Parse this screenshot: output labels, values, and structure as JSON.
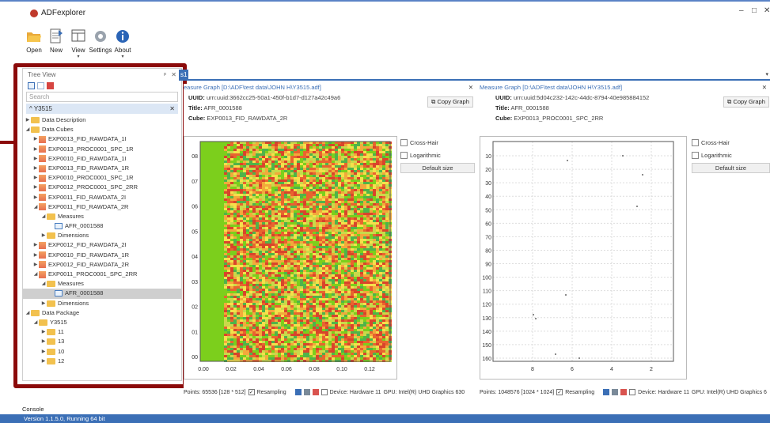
{
  "app": {
    "name": "ADFexplorer",
    "minimize": "–",
    "maximize": "□",
    "close": "✕"
  },
  "ribbon": [
    {
      "label": "Open",
      "icon": "folder-open-icon"
    },
    {
      "label": "New",
      "icon": "new-document-icon"
    },
    {
      "label": "View",
      "icon": "view-icon"
    },
    {
      "label": "Settings",
      "icon": "gear-icon"
    },
    {
      "label": "About",
      "icon": "info-icon"
    }
  ],
  "tree_view": {
    "title": "Tree View",
    "pin": "ᵖ",
    "close": "✕",
    "search_placeholder": "Search",
    "filter": "Y3515",
    "items": [
      {
        "t": "Data Description",
        "lvl": 0,
        "k": "folder",
        "exp": "▶"
      },
      {
        "t": "Data Cubes",
        "lvl": 0,
        "k": "folder",
        "exp": "◢"
      },
      {
        "t": "EXP0013_FID_RAWDATA_1I",
        "lvl": 1,
        "k": "cube",
        "exp": "▶"
      },
      {
        "t": "EXP0013_PROC0001_SPC_1R",
        "lvl": 1,
        "k": "cube",
        "exp": "▶"
      },
      {
        "t": "EXP0010_FID_RAWDATA_1I",
        "lvl": 1,
        "k": "cube",
        "exp": "▶"
      },
      {
        "t": "EXP0013_FID_RAWDATA_1R",
        "lvl": 1,
        "k": "cube",
        "exp": "▶"
      },
      {
        "t": "EXP0010_PROC0001_SPC_1R",
        "lvl": 1,
        "k": "cube",
        "exp": "▶"
      },
      {
        "t": "EXP0012_PROC0001_SPC_2RR",
        "lvl": 1,
        "k": "cube",
        "exp": "▶"
      },
      {
        "t": "EXP0011_FID_RAWDATA_2I",
        "lvl": 1,
        "k": "cube",
        "exp": "▶"
      },
      {
        "t": "EXP0011_FID_RAWDATA_2R",
        "lvl": 1,
        "k": "cube",
        "exp": "◢"
      },
      {
        "t": "Measures",
        "lvl": 2,
        "k": "folder",
        "exp": "◢"
      },
      {
        "t": "AFR_0001588",
        "lvl": 3,
        "k": "measure",
        "exp": ""
      },
      {
        "t": "Dimensions",
        "lvl": 2,
        "k": "folder",
        "exp": "▶"
      },
      {
        "t": "EXP0012_FID_RAWDATA_2I",
        "lvl": 1,
        "k": "cube",
        "exp": "▶"
      },
      {
        "t": "EXP0010_FID_RAWDATA_1R",
        "lvl": 1,
        "k": "cube",
        "exp": "▶"
      },
      {
        "t": "EXP0012_FID_RAWDATA_2R",
        "lvl": 1,
        "k": "cube",
        "exp": "▶"
      },
      {
        "t": "EXP0011_PROC0001_SPC_2RR",
        "lvl": 1,
        "k": "cube",
        "exp": "◢"
      },
      {
        "t": "Measures",
        "lvl": 2,
        "k": "folder",
        "exp": "◢"
      },
      {
        "t": "AFR_0001588",
        "lvl": 3,
        "k": "measure",
        "exp": "",
        "sel": true
      },
      {
        "t": "Dimensions",
        "lvl": 2,
        "k": "folder",
        "exp": "▶"
      },
      {
        "t": "Data Package",
        "lvl": 0,
        "k": "folder",
        "exp": "◢"
      },
      {
        "t": "Y3515",
        "lvl": 1,
        "k": "folder",
        "exp": "◢"
      },
      {
        "t": "11",
        "lvl": 2,
        "k": "folder",
        "exp": "▶"
      },
      {
        "t": "13",
        "lvl": 2,
        "k": "folder",
        "exp": "▶"
      },
      {
        "t": "10",
        "lvl": 2,
        "k": "folder",
        "exp": "▶"
      },
      {
        "t": "12",
        "lvl": 2,
        "k": "folder",
        "exp": "▶"
      }
    ]
  },
  "tab": {
    "label": "s1",
    "dropdown": "▾"
  },
  "graph_left": {
    "title": "easure Graph [D:\\ADF\\test data\\JOHN H\\Y3515.adf]",
    "close": "✕",
    "uuid_label": "UUID:",
    "uuid": "urn:uuid:3662cc25-50a1-450f-b1d7-d127a42c49a6",
    "title_label": "Title:",
    "title_val": "AFR_0001588",
    "cube_label": "Cube:",
    "cube": "EXP0013_FID_RAWDATA_2R",
    "copy": "Copy Graph",
    "crosshair": "Cross-Hair",
    "log": "Logarithmic",
    "default": "Default size",
    "points": "Points: 65536 [128 * 512]",
    "resampling": "Resampling",
    "device": "Device: Hardware 11",
    "gpu": "GPU: Intel(R) UHD Graphics 630"
  },
  "graph_right": {
    "title": "Measure Graph [D:\\ADF\\test data\\JOHN H\\Y3515.adf]",
    "close": "✕",
    "uuid_label": "UUID:",
    "uuid": "urn:uuid:5d04c232-142c-44dc-8794-40e985884152",
    "title_label": "Title:",
    "title_val": "AFR_0001588",
    "cube_label": "Cube:",
    "cube": "EXP0013_PROC0001_SPC_2RR",
    "copy": "Copy Graph",
    "crosshair": "Cross-Hair",
    "log": "Logarithmic",
    "default": "Default size",
    "points": "Points: 1048576 [1024 * 1024]",
    "resampling": "Resampling",
    "device": "Device: Hardware 11",
    "gpu": "GPU: Intel(R) UHD Graphics 6"
  },
  "chart_data": [
    {
      "type": "heatmap",
      "x_ticks": [
        "0.00",
        "0.02",
        "0.04",
        "0.06",
        "0.08",
        "0.10",
        "0.12"
      ],
      "y_ticks": [
        "08",
        "07",
        "06",
        "05",
        "04",
        "03",
        "02",
        "01",
        "00"
      ],
      "xlim": [
        0.0,
        0.13
      ]
    },
    {
      "type": "scatter",
      "x_ticks": [
        "8",
        "6",
        "4",
        "2"
      ],
      "y_ticks": [
        "10",
        "20",
        "30",
        "40",
        "50",
        "60",
        "70",
        "80",
        "90",
        "100",
        "110",
        "120",
        "130",
        "140",
        "150",
        "160"
      ],
      "grid": true
    }
  ],
  "bottom": {
    "console": "Console",
    "status": "Version 1.1.5.0, Running 64 bit"
  }
}
